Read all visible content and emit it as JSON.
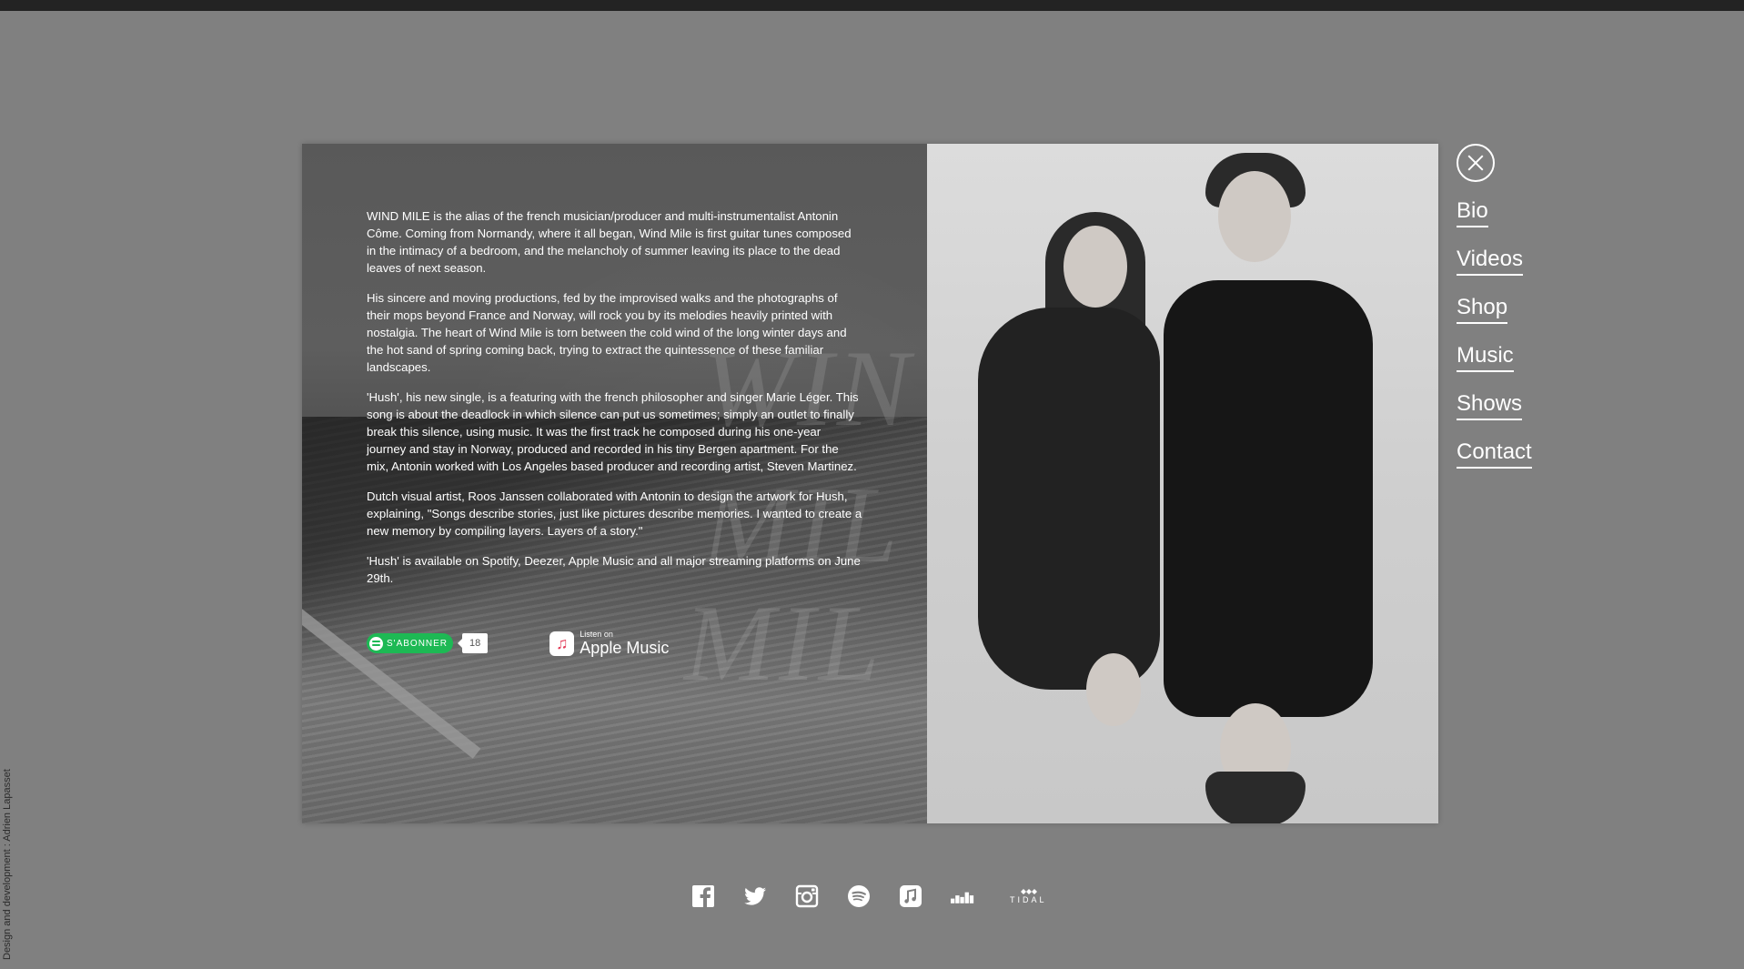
{
  "credit": "Design and development : Adrien Lapasset",
  "bio": {
    "paragraphs": [
      "WIND MILE is the alias of the french musician/producer and multi-instrumentalist Antonin Côme. Coming from Normandy, where it all began, Wind Mile is first guitar tunes composed in the intimacy of a bedroom, and the melancholy of summer leaving its place to the dead leaves of next season.",
      "His sincere and moving productions, fed by the improvised walks and the photographs of their mops beyond France and Norway, will rock you by its melodies heavily printed with nostalgia. The heart of Wind Mile is torn between the cold wind of the long winter days and the hot sand of spring coming back, trying to extract the quintessence of these familiar landscapes.",
      "'Hush', his new single, is a featuring with the french philosopher and singer Marie Léger. This song is about the deadlock in which silence can put us sometimes; simply an outlet to finally break this silence, using music. It was the first track he composed during his one-year journey and stay in Norway, produced and recorded in his tiny Bergen apartment. For the mix, Antonin worked with Los Angeles based producer and recording artist, Steven Martinez.",
      "Dutch visual artist, Roos Janssen collaborated with Antonin to design the artwork for Hush, explaining, \"Songs describe stories, just like pictures describe memories. I wanted to create a new memory by compiling layers. Layers of a story.\"",
      "'Hush' is available on Spotify, Deezer, Apple Music and all major streaming platforms on June 29th."
    ],
    "watermark": [
      "WIN",
      "MIL",
      "MIL"
    ]
  },
  "actions": {
    "spotify_subscribe": "S'ABONNER",
    "spotify_count": "18",
    "apple_small": "Listen on",
    "apple_big": "Apple Music"
  },
  "nav": {
    "items": [
      "Bio",
      "Videos",
      "Shop",
      "Music",
      "Shows",
      "Contact"
    ]
  },
  "footer": {
    "icons": [
      "facebook-icon",
      "twitter-icon",
      "instagram-icon",
      "spotify-icon",
      "apple-music-icon",
      "deezer-icon",
      "tidal-icon"
    ],
    "tidal_label": "TIDAL"
  },
  "colors": {
    "background": "#808080",
    "spotify_green": "#1db954",
    "text": "#ffffff"
  }
}
